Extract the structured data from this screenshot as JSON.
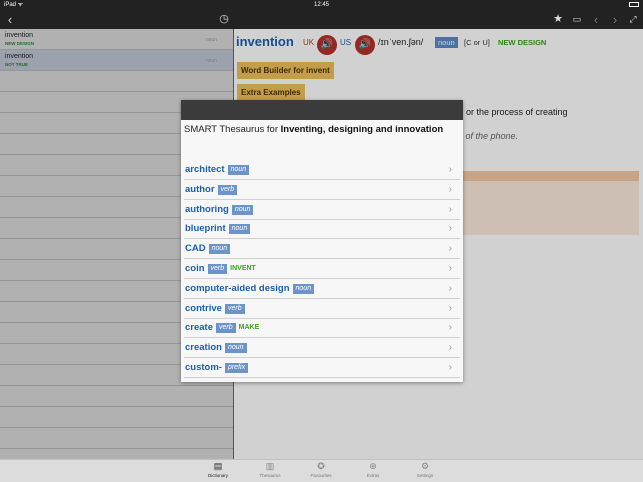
{
  "status": {
    "carrier": "iPad ᯤ",
    "time": "12:45"
  },
  "toolbar": {
    "icons": [
      "back-icon",
      "history-icon",
      "star-icon",
      "flashcard-icon",
      "prev-icon",
      "next-icon",
      "expand-icon"
    ]
  },
  "left_list": [
    {
      "word": "invention",
      "tag": "NEW DESIGN",
      "pos": "noun"
    },
    {
      "word": "invention",
      "tag": "NOT TRUE",
      "pos": "noun"
    }
  ],
  "entry": {
    "headword": "invention",
    "uk": "UK",
    "us": "US",
    "ipa": "/ɪnˈven.ʃən/",
    "pos": "noun",
    "grammar": "[C or U]",
    "label": "NEW DESIGN",
    "word_builder": "Word Builder for invent",
    "extra_examples": "Extra Examples",
    "definition_fragment": "e, or the process of creating",
    "example_fragment": "n of the phone."
  },
  "modal": {
    "title_prefix": "SMART Thesaurus for ",
    "title_bold": "Inventing, designing and innovation",
    "items": [
      {
        "word": "architect",
        "pos": "noun",
        "tag": ""
      },
      {
        "word": "author",
        "pos": "verb",
        "tag": ""
      },
      {
        "word": "authoring",
        "pos": "noun",
        "tag": ""
      },
      {
        "word": "blueprint",
        "pos": "noun",
        "tag": ""
      },
      {
        "word": "CAD",
        "pos": "noun",
        "tag": ""
      },
      {
        "word": "coin",
        "pos": "verb",
        "tag": "INVENT"
      },
      {
        "word": "computer-aided design",
        "pos": "noun",
        "tag": ""
      },
      {
        "word": "contrive",
        "pos": "verb",
        "tag": ""
      },
      {
        "word": "create",
        "pos": "verb",
        "tag": "MAKE"
      },
      {
        "word": "creation",
        "pos": "noun",
        "tag": ""
      },
      {
        "word": "custom-",
        "pos": "prefix",
        "tag": ""
      }
    ]
  },
  "tabs": [
    {
      "label": "Dictionary",
      "icon": "dictionary-icon",
      "active": true
    },
    {
      "label": "Thesaurus",
      "icon": "thesaurus-icon",
      "active": false
    },
    {
      "label": "Favourites",
      "icon": "favourites-icon",
      "active": false
    },
    {
      "label": "Extras",
      "icon": "extras-icon",
      "active": false
    },
    {
      "label": "Settings",
      "icon": "settings-icon",
      "active": false
    }
  ],
  "colors": {
    "accent": "#1d5fad",
    "pos_badge": "#6d94c8",
    "label_green": "#3aa21f",
    "speaker_red": "#b4332a",
    "button_orange": "#f0c05a"
  }
}
